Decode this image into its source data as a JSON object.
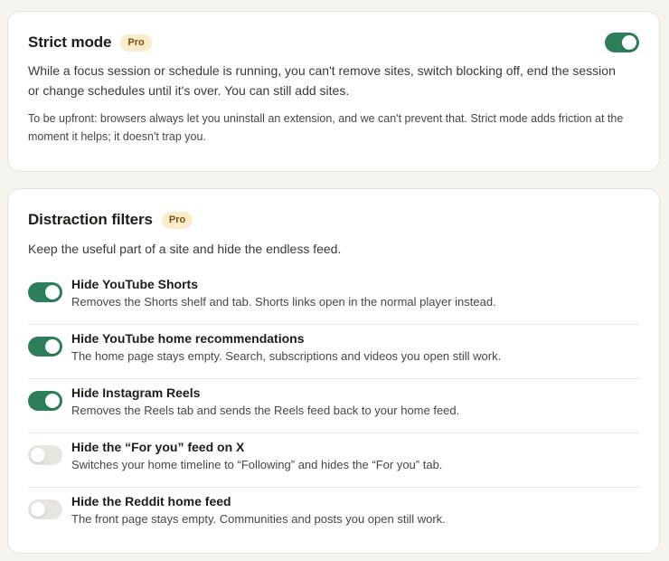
{
  "strict": {
    "title": "Strict mode",
    "badge": "Pro",
    "enabled": true,
    "description": "While a focus session or schedule is running, you can't remove sites, switch blocking off, end the session or change schedules until it's over. You can still add sites.",
    "note": "To be upfront: browsers always let you uninstall an extension, and we can't prevent that. Strict mode adds friction at the moment it helps; it doesn't trap you."
  },
  "filters": {
    "title": "Distraction filters",
    "badge": "Pro",
    "description": "Keep the useful part of a site and hide the endless feed.",
    "items": [
      {
        "label": "Hide YouTube Shorts",
        "help": "Removes the Shorts shelf and tab. Shorts links open in the normal player instead.",
        "enabled": true
      },
      {
        "label": "Hide YouTube home recommendations",
        "help": "The home page stays empty. Search, subscriptions and videos you open still work.",
        "enabled": true
      },
      {
        "label": "Hide Instagram Reels",
        "help": "Removes the Reels tab and sends the Reels feed back to your home feed.",
        "enabled": true
      },
      {
        "label": "Hide the “For you” feed on X",
        "help": "Switches your home timeline to “Following” and hides the “For you” tab.",
        "enabled": false
      },
      {
        "label": "Hide the Reddit home feed",
        "help": "The front page stays empty. Communities and posts you open still work.",
        "enabled": false
      }
    ]
  },
  "colors": {
    "toggle_on": "#2e7d5b",
    "toggle_off": "#e8e5df",
    "badge_bg": "#fbeccc",
    "badge_text": "#7a4f0e"
  }
}
